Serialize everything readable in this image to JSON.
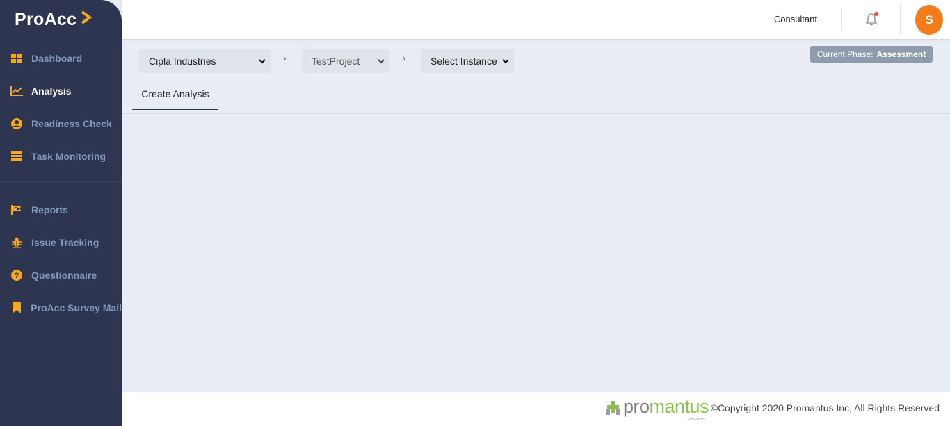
{
  "brand": {
    "name": "ProAcc"
  },
  "sidebar": {
    "items": [
      {
        "label": "Dashboard",
        "icon": "dashboard-icon",
        "active": false
      },
      {
        "label": "Analysis",
        "icon": "chart-line-icon",
        "active": true
      },
      {
        "label": "Readiness Check",
        "icon": "user-circle-icon",
        "active": false
      },
      {
        "label": "Task Monitoring",
        "icon": "list-icon",
        "active": false
      }
    ],
    "items2": [
      {
        "label": "Reports",
        "icon": "flag-icon"
      },
      {
        "label": "Issue Tracking",
        "icon": "bug-icon"
      },
      {
        "label": "Questionnaire",
        "icon": "question-circle-icon"
      },
      {
        "label": "ProAcc Survey Mail",
        "icon": "bookmark-icon"
      }
    ]
  },
  "header": {
    "role": "Consultant",
    "avatar_initial": "S",
    "notification_icon": "bell-icon"
  },
  "breadcrumb": {
    "company": "Cipla Industries",
    "project": "TestProject",
    "instance": "Select Instance",
    "separator": "›"
  },
  "phase": {
    "label": "Current Phase:",
    "value": "Assessment"
  },
  "tabs": [
    {
      "label": "Create Analysis",
      "active": true
    }
  ],
  "footer": {
    "logo_pro": "pro",
    "logo_mantus": "mantus",
    "logo_sub": "services",
    "copyright": "©Copyright 2020 Promantus Inc, All Rights Reserved"
  },
  "colors": {
    "sidebar_bg": "#2d3550",
    "accent_orange": "#f5a623",
    "avatar": "#f47c1a",
    "content_bg": "#e8ecf3"
  }
}
